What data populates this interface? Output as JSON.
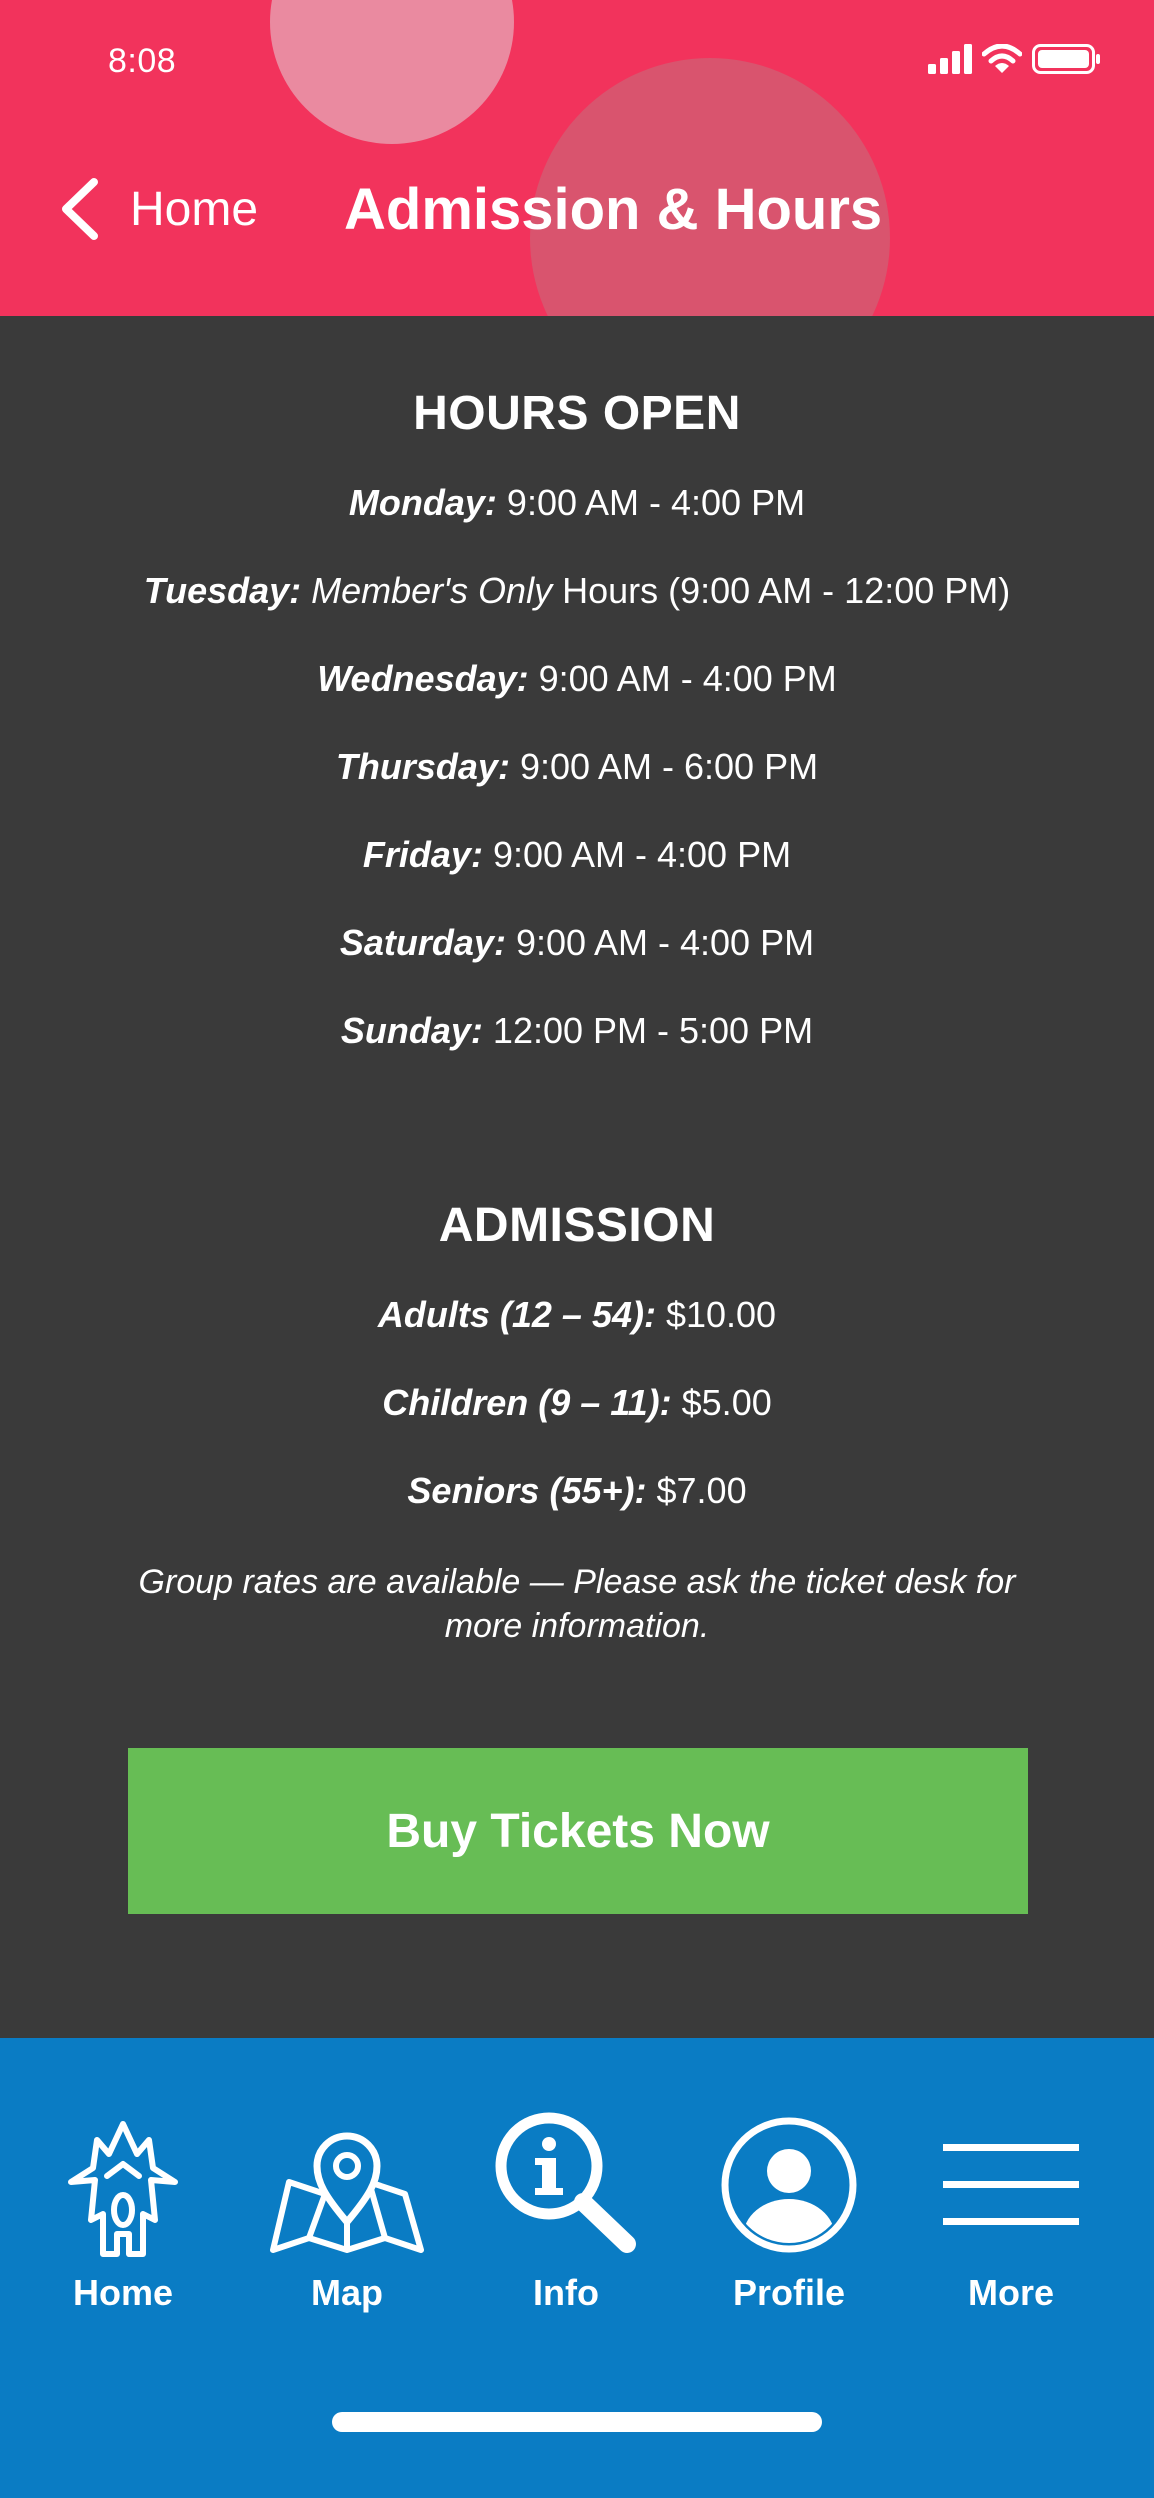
{
  "status_bar": {
    "time": "8:08"
  },
  "header": {
    "back_label": "Home",
    "title": "Admission & Hours"
  },
  "hours": {
    "heading": "HOURS OPEN",
    "monday": {
      "day": "Monday:",
      "time": " 9:00 AM - 4:00 PM"
    },
    "tuesday": {
      "day": "Tuesday:",
      "note": " Member's Only",
      "time": " Hours (9:00 AM - 12:00 PM)"
    },
    "wednesday": {
      "day": "Wednesday:",
      "time": " 9:00 AM - 4:00 PM"
    },
    "thursday": {
      "day": "Thursday:",
      "time": " 9:00 AM - 6:00 PM"
    },
    "friday": {
      "day": "Friday:",
      "time": " 9:00 AM - 4:00 PM"
    },
    "saturday": {
      "day": "Saturday:",
      "time": " 9:00 AM - 4:00 PM"
    },
    "sunday": {
      "day": "Sunday:",
      "time": " 12:00 PM - 5:00 PM"
    }
  },
  "admission": {
    "heading": "ADMISSION",
    "adults": {
      "label": "Adults (12 – 54):",
      "price": " $10.00"
    },
    "children": {
      "label": "Children (9 – 11):",
      "price": " $5.00"
    },
    "seniors": {
      "label": "Seniors (55+):",
      "price": " $7.00"
    },
    "note": "Group rates are available — Please ask the ticket desk for more information."
  },
  "buy_button_label": "Buy Tickets Now",
  "nav": {
    "home": "Home",
    "map": "Map",
    "info": "Info",
    "profile": "Profile",
    "more": "More"
  },
  "colors": {
    "header_bg": "#f2335c",
    "content_bg": "#3a3a3a",
    "buy_button": "#67bd55",
    "nav_bg": "#0a7cc4"
  },
  "icons": {
    "back": "chevron-left-icon",
    "signal": "cellular-signal-icon",
    "wifi": "wifi-icon",
    "battery": "battery-icon",
    "home": "house-icon",
    "map": "map-pin-icon",
    "info": "info-search-icon",
    "profile": "user-avatar-icon",
    "more": "hamburger-menu-icon"
  }
}
